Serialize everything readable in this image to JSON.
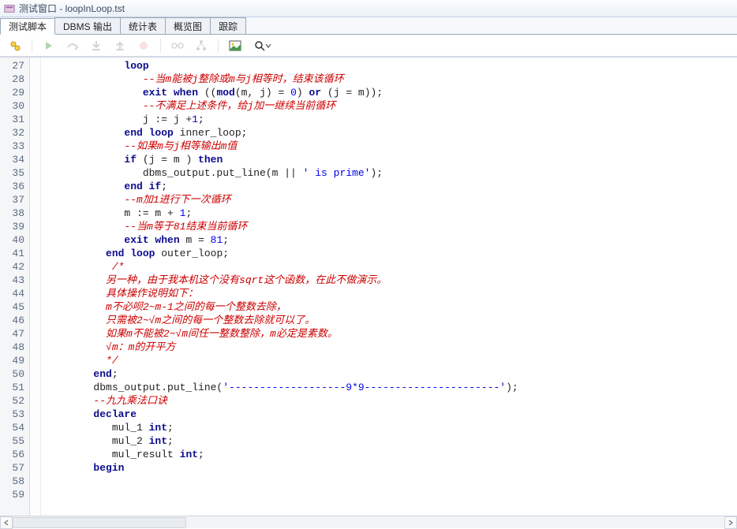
{
  "window": {
    "title": "测试窗口 - loopInLoop.tst"
  },
  "tabs": [
    {
      "label": "测试脚本",
      "active": true
    },
    {
      "label": "DBMS 输出"
    },
    {
      "label": "统计表"
    },
    {
      "label": "概览图"
    },
    {
      "label": "跟踪"
    }
  ],
  "toolbar": {
    "icons": [
      "beautifier",
      "run",
      "step-over",
      "step-into",
      "step-out",
      "breakpoint",
      "glasses",
      "tree",
      "image",
      "zoom-dropdown"
    ]
  },
  "editor": {
    "first_line_no": 27,
    "lines": [
      {
        "n": 27,
        "segs": [
          {
            "t": "             ",
            "c": ""
          },
          {
            "t": "loop",
            "c": "kw"
          }
        ]
      },
      {
        "n": 28,
        "segs": [
          {
            "t": "                ",
            "c": ""
          },
          {
            "t": "--当m能被j整除或m与j相等时，结束该循环",
            "c": "cm"
          }
        ]
      },
      {
        "n": 29,
        "segs": [
          {
            "t": "                ",
            "c": ""
          },
          {
            "t": "exit when",
            "c": "kw"
          },
          {
            "t": " ((",
            "c": ""
          },
          {
            "t": "mod",
            "c": "kw"
          },
          {
            "t": "(m, j) = ",
            "c": ""
          },
          {
            "t": "0",
            "c": "str"
          },
          {
            "t": ") ",
            "c": ""
          },
          {
            "t": "or",
            "c": "kw"
          },
          {
            "t": " (j = m));",
            "c": ""
          }
        ]
      },
      {
        "n": 30,
        "segs": [
          {
            "t": "                ",
            "c": ""
          },
          {
            "t": "--不满足上述条件，给j加一继续当前循环",
            "c": "cm"
          }
        ]
      },
      {
        "n": 31,
        "segs": [
          {
            "t": "                j := j +",
            "c": ""
          },
          {
            "t": "1",
            "c": "str"
          },
          {
            "t": ";",
            "c": ""
          }
        ]
      },
      {
        "n": 32,
        "segs": [
          {
            "t": "             ",
            "c": ""
          },
          {
            "t": "end loop",
            "c": "kw"
          },
          {
            "t": " inner_loop;",
            "c": ""
          }
        ]
      },
      {
        "n": 33,
        "segs": [
          {
            "t": "             ",
            "c": ""
          },
          {
            "t": "--如果m与j相等输出m值",
            "c": "cm"
          }
        ]
      },
      {
        "n": 34,
        "segs": [
          {
            "t": "             ",
            "c": ""
          },
          {
            "t": "if",
            "c": "kw"
          },
          {
            "t": " (j = m ) ",
            "c": ""
          },
          {
            "t": "then",
            "c": "kw"
          }
        ]
      },
      {
        "n": 35,
        "segs": [
          {
            "t": "                dbms_output.put_line(m || ",
            "c": ""
          },
          {
            "t": "' is prime'",
            "c": "str"
          },
          {
            "t": ");",
            "c": ""
          }
        ]
      },
      {
        "n": 36,
        "segs": [
          {
            "t": "             ",
            "c": ""
          },
          {
            "t": "end if",
            "c": "kw"
          },
          {
            "t": ";",
            "c": ""
          }
        ]
      },
      {
        "n": 37,
        "segs": [
          {
            "t": "             ",
            "c": ""
          },
          {
            "t": "--m加1进行下一次循环",
            "c": "cm"
          }
        ]
      },
      {
        "n": 38,
        "segs": [
          {
            "t": "             m := m + ",
            "c": ""
          },
          {
            "t": "1",
            "c": "str"
          },
          {
            "t": ";",
            "c": ""
          }
        ]
      },
      {
        "n": 39,
        "segs": [
          {
            "t": "             ",
            "c": ""
          },
          {
            "t": "--当m等于81结束当前循环",
            "c": "cm"
          }
        ]
      },
      {
        "n": 40,
        "segs": [
          {
            "t": "             ",
            "c": ""
          },
          {
            "t": "exit when",
            "c": "kw"
          },
          {
            "t": " m = ",
            "c": ""
          },
          {
            "t": "81",
            "c": "str"
          },
          {
            "t": ";",
            "c": ""
          }
        ]
      },
      {
        "n": 41,
        "segs": [
          {
            "t": "          ",
            "c": ""
          },
          {
            "t": "end loop",
            "c": "kw"
          },
          {
            "t": " outer_loop;",
            "c": ""
          }
        ]
      },
      {
        "n": 42,
        "segs": [
          {
            "t": "           ",
            "c": ""
          },
          {
            "t": "/*",
            "c": "cm"
          }
        ]
      },
      {
        "n": 43,
        "segs": [
          {
            "t": "          ",
            "c": ""
          },
          {
            "t": "另一种，由于我本机这个没有sqrt这个函数，在此不做演示。",
            "c": "cm"
          }
        ]
      },
      {
        "n": 44,
        "segs": [
          {
            "t": "          ",
            "c": ""
          },
          {
            "t": "具体操作说明如下：",
            "c": "cm"
          }
        ]
      },
      {
        "n": 45,
        "segs": [
          {
            "t": "          ",
            "c": ""
          },
          {
            "t": "m不必呗2~m-1之间的每一个整数去除，",
            "c": "cm"
          }
        ]
      },
      {
        "n": 46,
        "segs": [
          {
            "t": "          ",
            "c": ""
          },
          {
            "t": "只需被2~√m之间的每一个整数去除就可以了。",
            "c": "cm"
          }
        ]
      },
      {
        "n": 47,
        "segs": [
          {
            "t": "          ",
            "c": ""
          },
          {
            "t": "如果m不能被2~√m间任一整数整除，m必定是素数。",
            "c": "cm"
          }
        ]
      },
      {
        "n": 48,
        "segs": [
          {
            "t": "          ",
            "c": ""
          },
          {
            "t": "√m：m的开平方",
            "c": "cm"
          }
        ]
      },
      {
        "n": 49,
        "segs": [
          {
            "t": "          ",
            "c": ""
          },
          {
            "t": "*/",
            "c": "cm"
          }
        ]
      },
      {
        "n": 50,
        "segs": [
          {
            "t": "        ",
            "c": ""
          },
          {
            "t": "end",
            "c": "kw"
          },
          {
            "t": ";",
            "c": ""
          }
        ]
      },
      {
        "n": 51,
        "segs": [
          {
            "t": "",
            "c": ""
          }
        ]
      },
      {
        "n": 52,
        "segs": [
          {
            "t": "",
            "c": ""
          }
        ]
      },
      {
        "n": 53,
        "segs": [
          {
            "t": "        dbms_output.put_line(",
            "c": ""
          },
          {
            "t": "'-------------------9*9----------------------'",
            "c": "str"
          },
          {
            "t": ");",
            "c": ""
          }
        ]
      },
      {
        "n": 54,
        "segs": [
          {
            "t": "        ",
            "c": ""
          },
          {
            "t": "--九九乘法口诀",
            "c": "cm"
          }
        ]
      },
      {
        "n": 55,
        "segs": [
          {
            "t": "        ",
            "c": ""
          },
          {
            "t": "declare",
            "c": "kw"
          }
        ]
      },
      {
        "n": 56,
        "segs": [
          {
            "t": "           mul_1 ",
            "c": ""
          },
          {
            "t": "int",
            "c": "kw"
          },
          {
            "t": ";",
            "c": ""
          }
        ]
      },
      {
        "n": 57,
        "segs": [
          {
            "t": "           mul_2 ",
            "c": ""
          },
          {
            "t": "int",
            "c": "kw"
          },
          {
            "t": ";",
            "c": ""
          }
        ]
      },
      {
        "n": 58,
        "segs": [
          {
            "t": "           mul_result ",
            "c": ""
          },
          {
            "t": "int",
            "c": "kw"
          },
          {
            "t": ";",
            "c": ""
          }
        ]
      },
      {
        "n": 59,
        "segs": [
          {
            "t": "        ",
            "c": ""
          },
          {
            "t": "begin",
            "c": "kw"
          }
        ]
      }
    ]
  }
}
